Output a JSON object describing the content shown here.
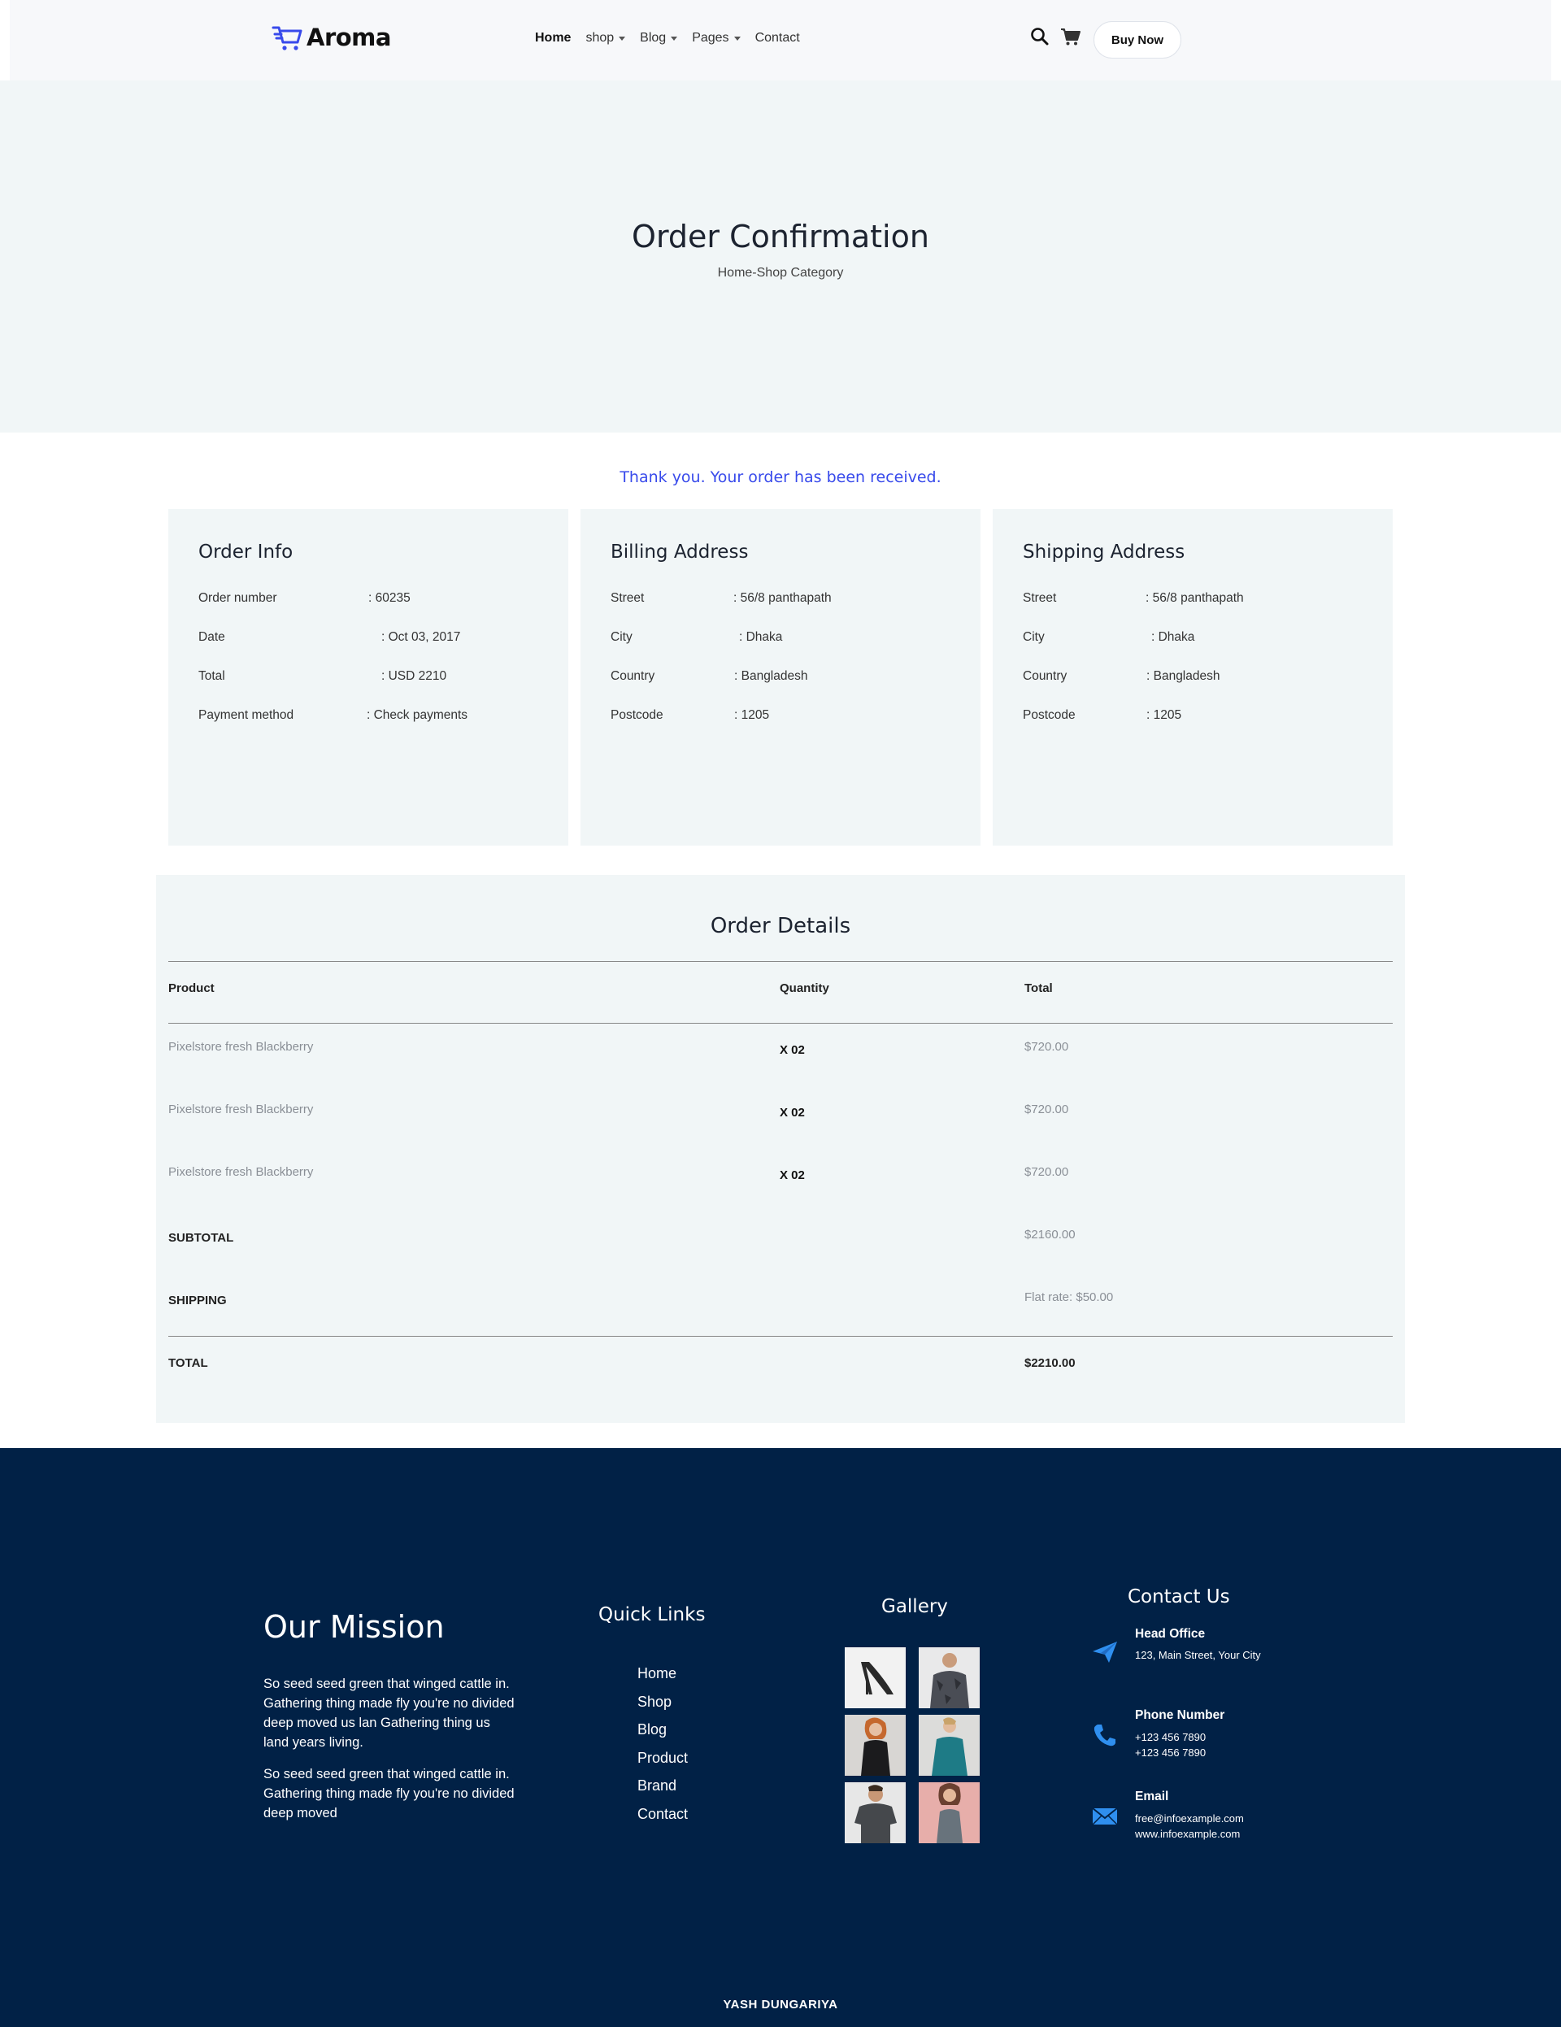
{
  "brand": {
    "name": "Aroma",
    "accent": "#384aeb",
    "footer_bg": "#012146"
  },
  "nav": {
    "items": [
      {
        "label": "Home",
        "active": true,
        "dropdown": false
      },
      {
        "label": "shop",
        "active": false,
        "dropdown": true
      },
      {
        "label": "Blog",
        "active": false,
        "dropdown": true
      },
      {
        "label": "Pages",
        "active": false,
        "dropdown": true
      },
      {
        "label": "Contact",
        "active": false,
        "dropdown": false
      }
    ],
    "icons": [
      "search-icon",
      "cart-icon"
    ],
    "cta": "Buy Now"
  },
  "hero": {
    "title": "Order Confirmation",
    "breadcrumb": "Home-Shop Category"
  },
  "thanks": "Thank you. Your order has been received.",
  "order_info": {
    "title": "Order Info",
    "rows": [
      {
        "label": "Order number",
        "value": ": 60235"
      },
      {
        "label": "Date",
        "value": ": Oct 03, 2017"
      },
      {
        "label": "Total",
        "value": ": USD 2210"
      },
      {
        "label": "Payment method",
        "value": ": Check payments"
      }
    ]
  },
  "billing": {
    "title": "Billing Address",
    "rows": [
      {
        "label": "Street",
        "value": ": 56/8 panthapath"
      },
      {
        "label": "City",
        "value": ": Dhaka"
      },
      {
        "label": "Country",
        "value": ": Bangladesh"
      },
      {
        "label": "Postcode",
        "value": ": 1205"
      }
    ]
  },
  "shipping": {
    "title": "Shipping Address",
    "rows": [
      {
        "label": "Street",
        "value": ": 56/8 panthapath"
      },
      {
        "label": "City",
        "value": ": Dhaka"
      },
      {
        "label": "Country",
        "value": ": Bangladesh"
      },
      {
        "label": "Postcode",
        "value": ": 1205"
      }
    ]
  },
  "details": {
    "title": "Order Details",
    "headers": [
      "Product",
      "Quantity",
      "Total"
    ],
    "items": [
      {
        "product": "Pixelstore fresh Blackberry",
        "qty": "X 02",
        "total": "$720.00"
      },
      {
        "product": "Pixelstore fresh Blackberry",
        "qty": "X 02",
        "total": "$720.00"
      },
      {
        "product": "Pixelstore fresh Blackberry",
        "qty": "X 02",
        "total": "$720.00"
      }
    ],
    "subtotal_label": "SUBTOTAL",
    "subtotal": "$2160.00",
    "shipping_label": "SHIPPING",
    "shipping": "Flat rate: $50.00",
    "total_label": "TOTAL",
    "total": "$2210.00"
  },
  "footer": {
    "mission": {
      "title": "Our Mission",
      "p1": "So seed seed green that winged cattle in. Gathering thing made fly you're no divided deep moved us lan Gathering thing us land years living.",
      "p2": "So seed seed green that winged cattle in. Gathering thing made fly you're no divided deep moved"
    },
    "quick_links": {
      "title": "Quick Links",
      "items": [
        "Home",
        "Shop",
        "Blog",
        "Product",
        "Brand",
        "Contact"
      ]
    },
    "gallery": {
      "title": "Gallery"
    },
    "contact": {
      "title": "Contact Us",
      "head_office": {
        "label": "Head Office",
        "lines": [
          "123, Main Street, Your City"
        ]
      },
      "phone": {
        "label": "Phone Number",
        "lines": [
          "+123 456 7890",
          "+123 456 7890"
        ]
      },
      "email": {
        "label": "Email",
        "lines": [
          "free@infoexample.com",
          "www.infoexample.com"
        ]
      }
    },
    "credit": "YASH DUNGARIYA"
  }
}
